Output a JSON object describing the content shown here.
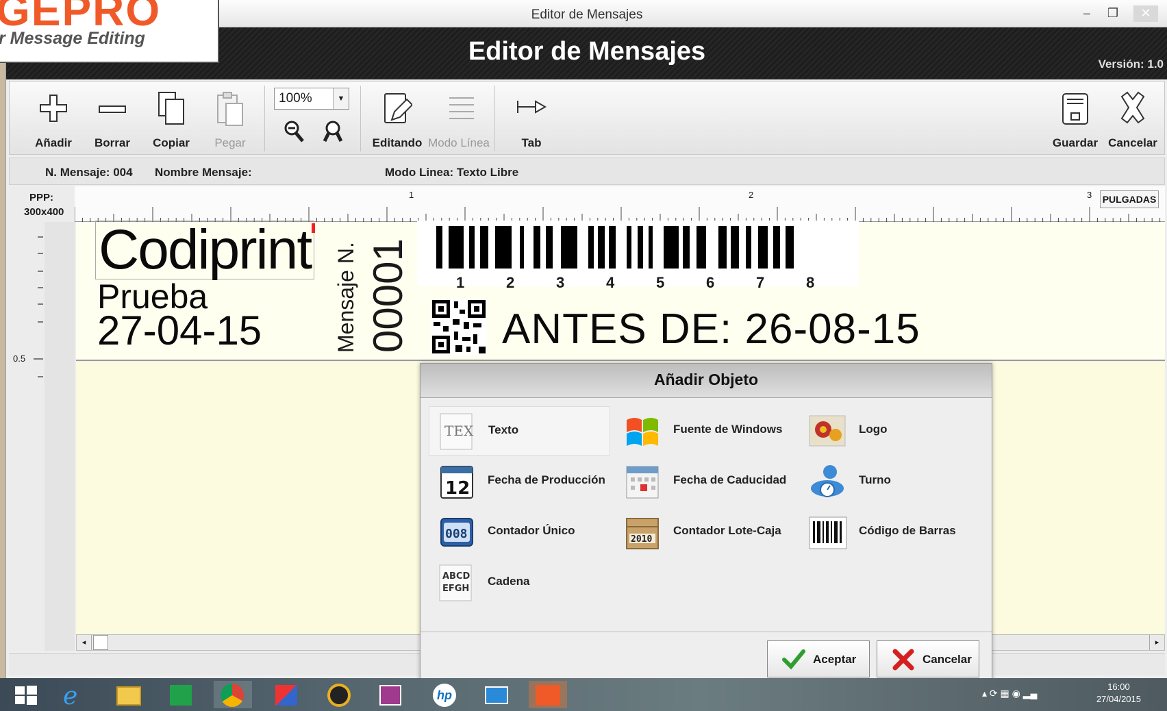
{
  "window": {
    "title": "Editor de Mensajes",
    "minimize_glyph": "–",
    "restore_glyph": "❐",
    "close_glyph": "✕"
  },
  "header": {
    "title": "Editor de Mensajes",
    "version": "Versión: 1.0"
  },
  "logo": {
    "brand": "GEPRO",
    "brand_visible": "GEPRO",
    "tagline": "r Message Editing",
    "brand_color": "#f05a28"
  },
  "toolbar": {
    "add_label": "Añadir",
    "delete_label": "Borrar",
    "copy_label": "Copiar",
    "paste_label": "Pegar",
    "zoom_value": "100%",
    "editing_label": "Editando",
    "line_mode_label": "Modo Línea",
    "tab_label": "Tab",
    "save_label": "Guardar",
    "cancel_label": "Cancelar"
  },
  "infobar": {
    "msg_number": "N. Mensaje:  004",
    "msg_name": "Nombre Mensaje:",
    "line_mode": "Modo Linea:  Texto Libre"
  },
  "ruler": {
    "ppp_label": "PPP:",
    "ppp_value": "300x400",
    "units_button": "PULGADAS",
    "marks": [
      "1",
      "2",
      "3"
    ],
    "left_mark": "0.5"
  },
  "label": {
    "company": "Codiprint",
    "test_text": "Prueba",
    "production_date": "27-04-15",
    "msg_caption": "Mensaje N.",
    "msg_counter": "00001",
    "barcode_digits": [
      "1",
      "2",
      "3",
      "4",
      "5",
      "6",
      "7",
      "8"
    ],
    "expiry": "ANTES  DE: 26-08-15"
  },
  "dialog": {
    "title": "Añadir Objeto",
    "options": {
      "text": "Texto",
      "windows_font": "Fuente de Windows",
      "logo": "Logo",
      "production_date": "Fecha de Producción",
      "expiry_date": "Fecha de Caducidad",
      "shift": "Turno",
      "unique_counter": "Contador Único",
      "batch_counter": "Contador Lote-Caja",
      "barcode": "Código de Barras",
      "string": "Cadena"
    },
    "icon_text": {
      "tex": "TEX",
      "calendar_day": "12",
      "counter": "008",
      "batch": "2010",
      "string_l1": "ABCD",
      "string_l2": "EFGH"
    },
    "accept": "Aceptar",
    "cancel": "Cancelar"
  },
  "taskbar": {
    "clock_time": "16:00",
    "clock_date": "27/04/2015",
    "apps": [
      "windows-start-icon",
      "internet-explorer-icon",
      "file-explorer-icon",
      "store-icon",
      "chrome-icon",
      "app-puzzle-icon",
      "media-icon",
      "presentation-icon",
      "hp-icon",
      "mail-icon",
      "gepro-app-icon"
    ]
  }
}
